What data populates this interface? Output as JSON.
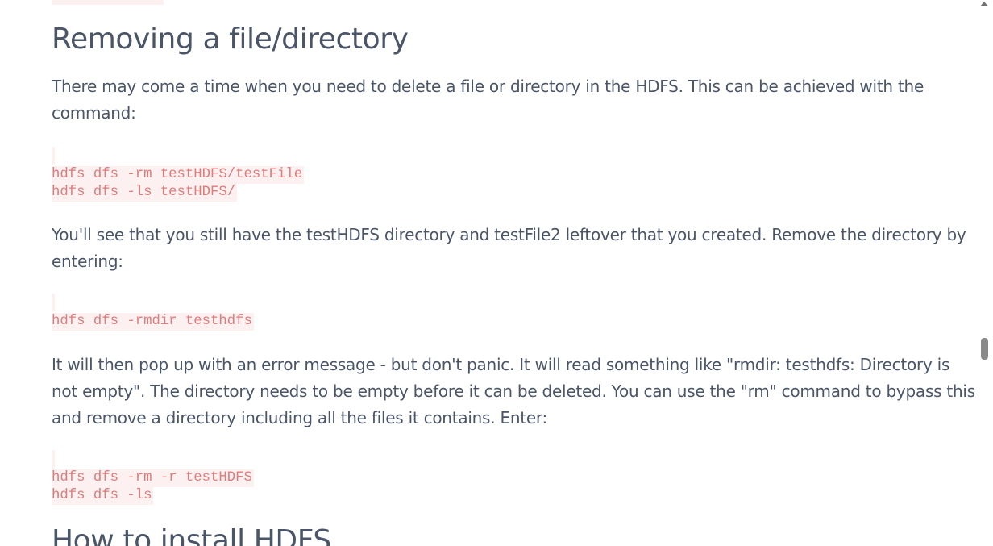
{
  "article": {
    "heading_removing": "Removing a file/directory",
    "para_1": "There may come a time when you need to delete a file or directory in the HDFS. This can be achieved with the command:",
    "code_1": {
      "line_1": "hdfs dfs -rm testHDFS/testFile",
      "line_2": "hdfs dfs -ls testHDFS/"
    },
    "para_2": "You'll see that you still have the testHDFS directory and testFile2 leftover that you created. Remove the directory by entering:",
    "code_2": {
      "line_1": "hdfs dfs -rmdir testhdfs"
    },
    "para_3": "It will then pop up with an error message - but don't panic. It will read something like \"rmdir: testhdfs: Directory is not empty\". The directory needs to be empty before it can be deleted. You can use the \"rm\" command to bypass this and remove a directory including all the files it contains. Enter:",
    "code_3": {
      "line_1": "hdfs dfs -rm -r testHDFS",
      "line_2": "hdfs dfs -ls"
    },
    "heading_install": "How to install HDFS"
  },
  "colors": {
    "text": "#4a5568",
    "code_text": "#e07b7b",
    "code_background": "#fdf0f0"
  },
  "icons": {
    "scroll_up": "scroll-up-arrow-icon"
  }
}
